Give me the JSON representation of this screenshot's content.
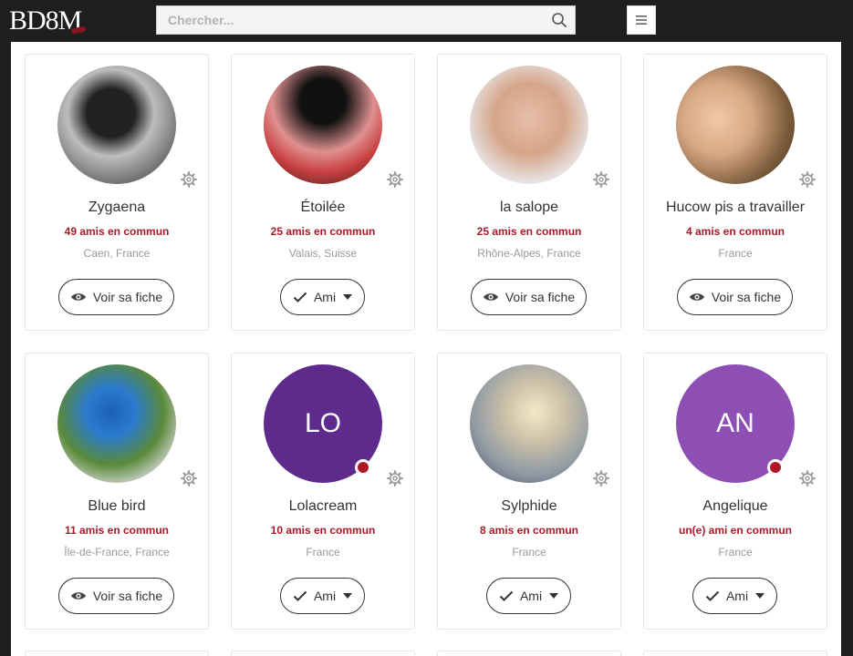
{
  "header": {
    "logo_text": "BD8M",
    "search_placeholder": "Chercher...",
    "colors": {
      "bar": "#1e1e1e",
      "accent": "#a51d28"
    }
  },
  "cards": [
    {
      "name": "Zygaena",
      "mutual": "49 amis en commun",
      "location": "Caen, France",
      "action": "Voir sa fiche",
      "action_type": "view",
      "avatar": "photo",
      "avatar_alt": "profile-photo",
      "online": false
    },
    {
      "name": "Étoilée",
      "mutual": "25 amis en commun",
      "location": "Valais, Suisse",
      "action": "Ami",
      "action_type": "friend",
      "avatar": "photo",
      "avatar_alt": "profile-photo",
      "online": false
    },
    {
      "name": "la salope",
      "mutual": "25 amis en commun",
      "location": "Rhône-Alpes, France",
      "action": "Voir sa fiche",
      "action_type": "view",
      "avatar": "photo",
      "avatar_alt": "profile-photo",
      "online": false
    },
    {
      "name": "Hucow pis a travailler",
      "mutual": "4 amis en commun",
      "location": "France",
      "action": "Voir sa fiche",
      "action_type": "view",
      "avatar": "photo",
      "avatar_alt": "profile-photo",
      "online": false
    },
    {
      "name": "Blue bird",
      "mutual": "11 amis en commun",
      "location": "Île-de-France, France",
      "action": "Voir sa fiche",
      "action_type": "view",
      "avatar": "photo",
      "avatar_alt": "bird-photo",
      "online": false
    },
    {
      "name": "Lolacream",
      "mutual": "10 amis en commun",
      "location": "France",
      "action": "Ami",
      "action_type": "friend",
      "avatar": "initials",
      "initials": "LO",
      "avatar_color": "#5e2a8c",
      "online": true
    },
    {
      "name": "Sylphide",
      "mutual": "8 amis en commun",
      "location": "France",
      "action": "Ami",
      "action_type": "friend",
      "avatar": "photo",
      "avatar_alt": "profile-photo",
      "online": false
    },
    {
      "name": "Angelique",
      "mutual": "un(e) ami en commun",
      "location": "France",
      "action": "Ami",
      "action_type": "friend",
      "avatar": "initials",
      "initials": "AN",
      "avatar_color": "#8e4fb5",
      "online": true
    }
  ]
}
